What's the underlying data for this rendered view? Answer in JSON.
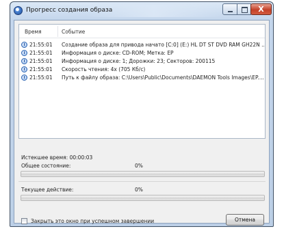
{
  "window": {
    "title": "Прогресс создания образа",
    "close_glyph": "X"
  },
  "log": {
    "columns": {
      "time": "Время",
      "event": "Событие"
    },
    "rows": [
      {
        "time": "21:55:01",
        "event": "Создание образа для привода начато [C:0] (E:) HL DT ST DVD RAM GH22N ..."
      },
      {
        "time": "21:55:01",
        "event": "Информация о диске: CD-ROM; Метка: EP"
      },
      {
        "time": "21:55:01",
        "event": "Информация о диске: 1; Дорожки: 23; Секторов: 200115"
      },
      {
        "time": "21:55:01",
        "event": "Скорость чтения: 4x (705 Кб/с)"
      },
      {
        "time": "21:55:01",
        "event": "Путь к файлу образа: C:\\Users\\Public\\Documents\\DAEMON Tools Images\\EP...."
      }
    ],
    "row_icon": "info-clock-icon"
  },
  "status": {
    "elapsed_label": "Истекшее время: 00:00:03",
    "overall_label": "Общее состояние:",
    "overall_percent_text": "0%",
    "overall_progress": 0,
    "current_label": "Текущее действие:",
    "current_percent_text": "0%",
    "current_progress": 0
  },
  "footer": {
    "close_on_success_label": "Закрыть это окно при успешном завершении",
    "close_on_success_checked": false,
    "cancel_label": "Отмена"
  },
  "colors": {
    "progress_fill": "#37b022",
    "title_bar": "#c4d6ec",
    "close_button": "#c44129"
  }
}
